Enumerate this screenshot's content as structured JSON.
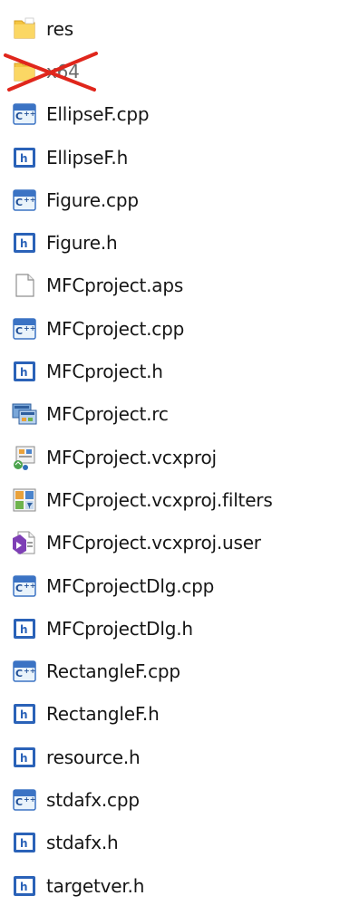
{
  "files": [
    {
      "name": "res",
      "type": "folder"
    },
    {
      "name": "x64",
      "type": "folder-deleted"
    },
    {
      "name": "EllipseF.cpp",
      "type": "cpp"
    },
    {
      "name": "EllipseF.h",
      "type": "h"
    },
    {
      "name": "Figure.cpp",
      "type": "cpp"
    },
    {
      "name": "Figure.h",
      "type": "h"
    },
    {
      "name": "MFCproject.aps",
      "type": "blank"
    },
    {
      "name": "MFCproject.cpp",
      "type": "cpp"
    },
    {
      "name": "MFCproject.h",
      "type": "h"
    },
    {
      "name": "MFCproject.rc",
      "type": "rc"
    },
    {
      "name": "MFCproject.vcxproj",
      "type": "vcxproj"
    },
    {
      "name": "MFCproject.vcxproj.filters",
      "type": "filters"
    },
    {
      "name": "MFCproject.vcxproj.user",
      "type": "user"
    },
    {
      "name": "MFCprojectDlg.cpp",
      "type": "cpp"
    },
    {
      "name": "MFCprojectDlg.h",
      "type": "h"
    },
    {
      "name": "RectangleF.cpp",
      "type": "cpp"
    },
    {
      "name": "RectangleF.h",
      "type": "h"
    },
    {
      "name": "resource.h",
      "type": "h"
    },
    {
      "name": "stdafx.cpp",
      "type": "cpp"
    },
    {
      "name": "stdafx.h",
      "type": "h"
    },
    {
      "name": "targetver.h",
      "type": "h"
    }
  ],
  "colors": {
    "folder": "#f4c542",
    "header_icon_blue": "#2a62b8",
    "strike_red": "#e0261c",
    "text": "#161616"
  }
}
